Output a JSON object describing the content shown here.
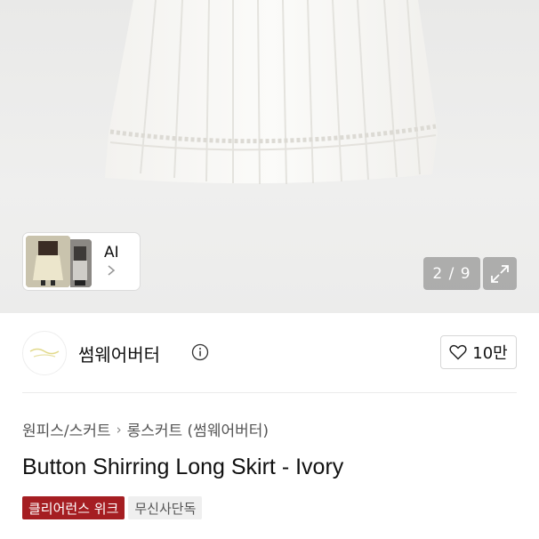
{
  "gallery": {
    "ai_card": {
      "label": "AI",
      "chevron": "chevron-right-icon"
    },
    "pager": "2 / 9",
    "expand_icon": "expand-icon"
  },
  "brand": {
    "name": "썸웨어버터",
    "info_icon": "info-icon",
    "like": {
      "icon": "heart-icon",
      "count": "10만"
    }
  },
  "product": {
    "breadcrumb": [
      "원피스/스커트",
      "롱스커트 (썸웨어버터)"
    ],
    "breadcrumb_sep": "›",
    "title": "Button Shirring Long Skirt - Ivory",
    "badges": {
      "sale": "클리어런스 위크",
      "exclusive": "무신사단독"
    }
  },
  "colors": {
    "sale_badge": "#a51e22",
    "hero_bg": "#ececeb"
  }
}
